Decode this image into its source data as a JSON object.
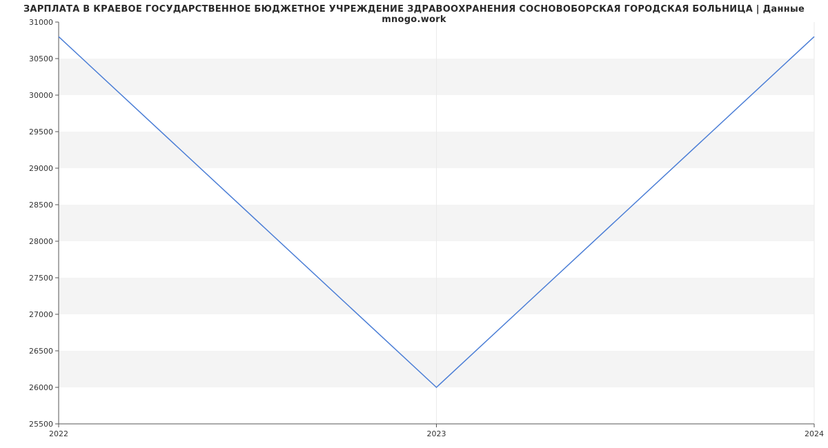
{
  "chart_data": {
    "type": "line",
    "title": "ЗАРПЛАТА В КРАЕВОЕ ГОСУДАРСТВЕННОЕ БЮДЖЕТНОЕ УЧРЕЖДЕНИЕ ЗДРАВООХРАНЕНИЯ СОСНОВОБОРСКАЯ ГОРОДСКАЯ БОЛЬНИЦА | Данные mnogo.work",
    "xlabel": "",
    "ylabel": "",
    "x": [
      2022,
      2023,
      2024
    ],
    "values": [
      30800,
      26000,
      30800
    ],
    "x_ticks": [
      2022,
      2023,
      2024
    ],
    "y_ticks": [
      25500,
      26000,
      26500,
      27000,
      27500,
      28000,
      28500,
      29000,
      29500,
      30000,
      30500,
      31000
    ],
    "xlim": [
      2022,
      2024
    ],
    "ylim": [
      25500,
      31000
    ],
    "line_color": "#4b7ed6",
    "band_color": "#f4f4f4"
  }
}
